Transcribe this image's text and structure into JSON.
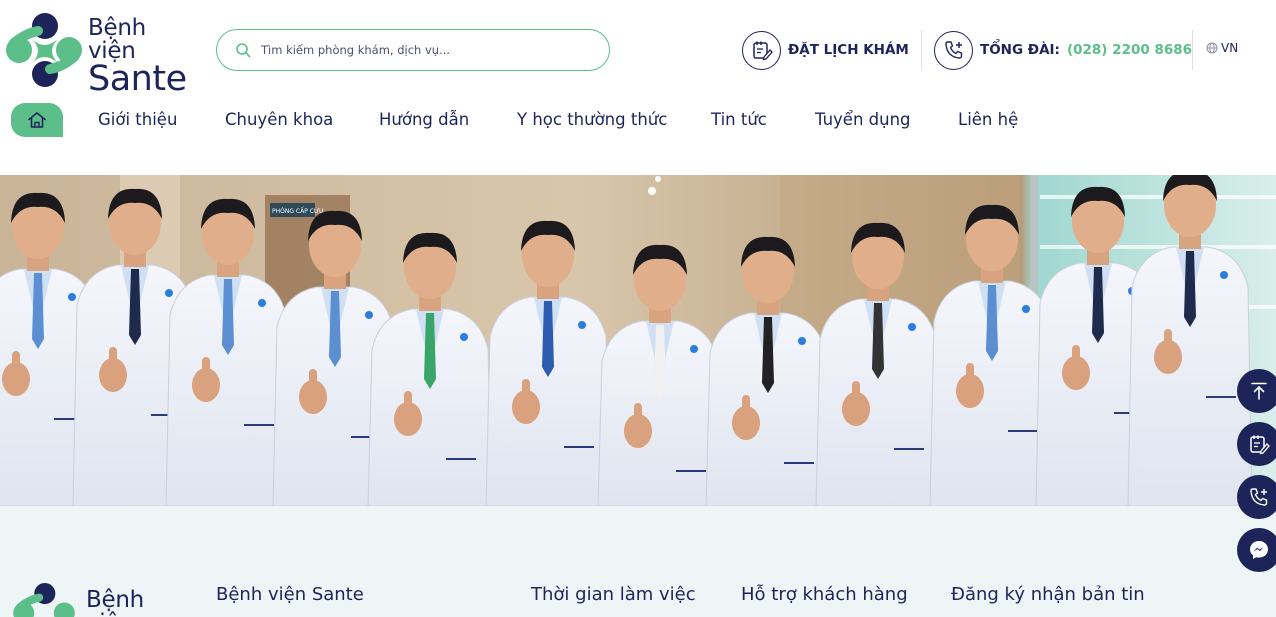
{
  "brand": {
    "line1": "Bệnh viện",
    "line2": "Sante"
  },
  "search": {
    "placeholder": "Tìm kiếm phòng khám, dịch vụ..."
  },
  "header_actions": {
    "booking_label": "ĐẶT LỊCH KHÁM",
    "hotline_label": "TỔNG ĐÀI:",
    "hotline_number": "(028) 2200 8686",
    "language": "VN"
  },
  "nav": {
    "items": [
      {
        "label": "Giới thiệu"
      },
      {
        "label": "Chuyên khoa"
      },
      {
        "label": "Hướng dẫn"
      },
      {
        "label": "Y học thường thức"
      },
      {
        "label": "Tin tức"
      },
      {
        "label": "Tuyển dụng"
      },
      {
        "label": "Liên hệ"
      }
    ]
  },
  "hero": {
    "wall_sign": "PHÒNG CẤP CỨU"
  },
  "footer": {
    "columns": [
      {
        "title": "Bệnh viện Sante"
      },
      {
        "title": "Thời gian làm việc"
      },
      {
        "title": "Hỗ trợ khách hàng"
      },
      {
        "title": "Đăng ký nhận bản tin"
      }
    ]
  },
  "floating_buttons": [
    {
      "icon": "arrow-up-icon"
    },
    {
      "icon": "calendar-edit-icon"
    },
    {
      "icon": "phone-plus-icon"
    },
    {
      "icon": "messenger-icon"
    }
  ],
  "colors": {
    "brand_navy": "#1d2459",
    "brand_green": "#5cbf8a",
    "footer_bg": "#eef5f7"
  }
}
